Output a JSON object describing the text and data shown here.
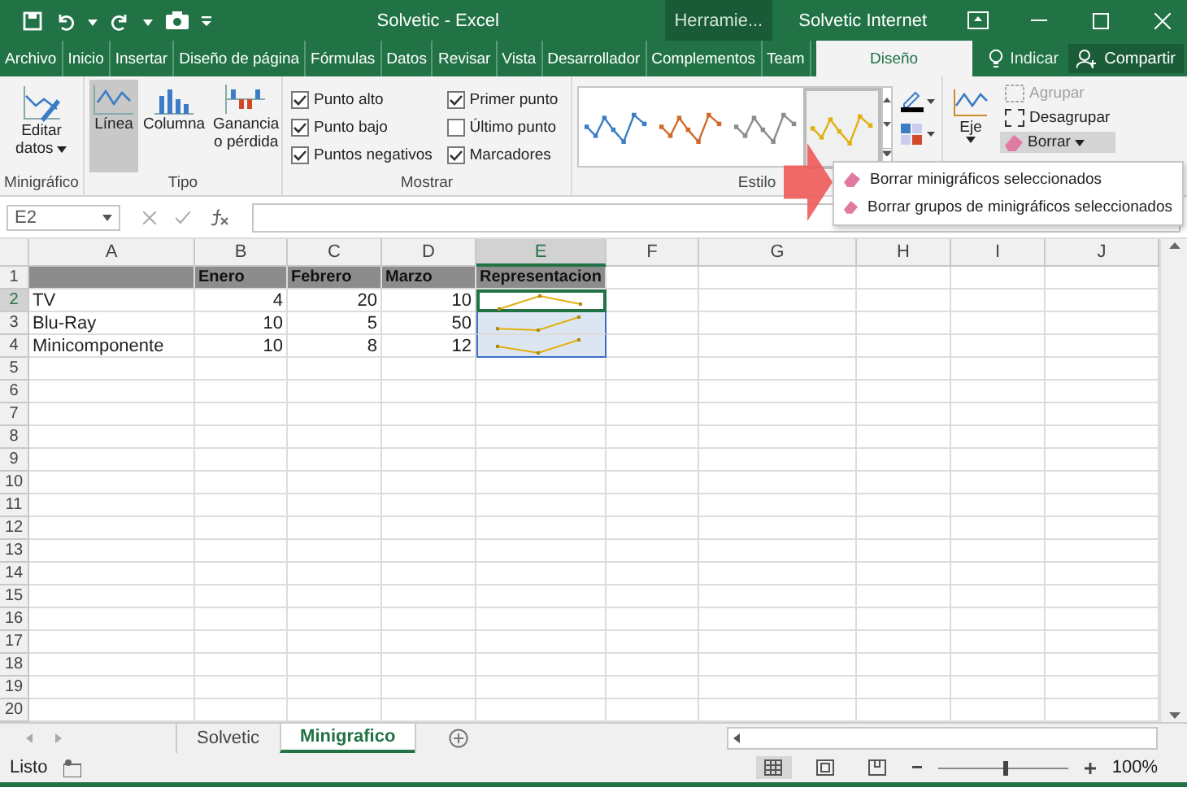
{
  "title_bar": {
    "title": "Solvetic - Excel",
    "context_label": "Herramie...",
    "account": "Solvetic Internet"
  },
  "ribbon_tabs": [
    {
      "label": "Archivo",
      "selected": false
    },
    {
      "label": "Inicio",
      "selected": false
    },
    {
      "label": "Insertar",
      "selected": false
    },
    {
      "label": "Diseño de página",
      "selected": false
    },
    {
      "label": "Fórmulas",
      "selected": false
    },
    {
      "label": "Datos",
      "selected": false
    },
    {
      "label": "Revisar",
      "selected": false
    },
    {
      "label": "Vista",
      "selected": false
    },
    {
      "label": "Desarrollador",
      "selected": false
    },
    {
      "label": "Complementos",
      "selected": false
    },
    {
      "label": "Team",
      "selected": false
    },
    {
      "label": "Diseño",
      "selected": true
    }
  ],
  "tell_me": "Indicar",
  "share": "Compartir",
  "ribbon": {
    "minigrafico": {
      "label": "Minigráfico",
      "edit_button": "Editar datos"
    },
    "tipo": {
      "label": "Tipo",
      "types": [
        {
          "label": "Línea",
          "selected": true
        },
        {
          "label": "Columna",
          "selected": false
        },
        {
          "label": "Ganancia o pérdida",
          "selected": false
        }
      ]
    },
    "mostrar": {
      "label": "Mostrar",
      "options": [
        {
          "label": "Punto alto",
          "checked": true
        },
        {
          "label": "Punto bajo",
          "checked": true
        },
        {
          "label": "Puntos negativos",
          "checked": true
        },
        {
          "label": "Primer punto",
          "checked": true
        },
        {
          "label": "Último punto",
          "checked": false
        },
        {
          "label": "Marcadores",
          "checked": true
        }
      ]
    },
    "estilo": {
      "label": "Estilo",
      "styles": [
        {
          "color": "#3a7dc4",
          "selected": false
        },
        {
          "color": "#d06a2a",
          "selected": false
        },
        {
          "color": "#8c8c8c",
          "selected": false
        },
        {
          "color": "#e0b010",
          "selected": true
        }
      ]
    },
    "agrupar": {
      "axis_button": "Eje",
      "buttons": [
        {
          "label": "Agrupar",
          "disabled": true,
          "expanded": false
        },
        {
          "label": "Desagrupar",
          "disabled": false,
          "expanded": false
        },
        {
          "label": "Borrar",
          "disabled": false,
          "expanded": true
        }
      ]
    }
  },
  "dropdown_menu": [
    "Borrar minigráficos seleccionados",
    "Borrar grupos de minigráficos seleccionados"
  ],
  "formula_bar": {
    "name_box": "E2"
  },
  "sheet": {
    "columns": [
      {
        "label": "A",
        "selected": false
      },
      {
        "label": "B",
        "selected": false
      },
      {
        "label": "C",
        "selected": false
      },
      {
        "label": "D",
        "selected": false
      },
      {
        "label": "E",
        "selected": true
      },
      {
        "label": "F",
        "selected": false
      },
      {
        "label": "G",
        "selected": false
      },
      {
        "label": "H",
        "selected": false
      },
      {
        "label": "I",
        "selected": false
      },
      {
        "label": "J",
        "selected": false
      }
    ],
    "row_headers": [
      {
        "label": "1",
        "selected": false
      },
      {
        "label": "2",
        "selected": true
      },
      {
        "label": "3",
        "selected": false
      },
      {
        "label": "4",
        "selected": false
      },
      {
        "label": "5",
        "selected": false
      },
      {
        "label": "6",
        "selected": false
      },
      {
        "label": "7",
        "selected": false
      },
      {
        "label": "8",
        "selected": false
      },
      {
        "label": "9",
        "selected": false
      },
      {
        "label": "10",
        "selected": false
      },
      {
        "label": "11",
        "selected": false
      },
      {
        "label": "12",
        "selected": false
      },
      {
        "label": "13",
        "selected": false
      },
      {
        "label": "14",
        "selected": false
      },
      {
        "label": "15",
        "selected": false
      },
      {
        "label": "16",
        "selected": false
      },
      {
        "label": "17",
        "selected": false
      },
      {
        "label": "18",
        "selected": false
      },
      {
        "label": "19",
        "selected": false
      },
      {
        "label": "20",
        "selected": false
      }
    ],
    "header_row": [
      "Enero",
      "Febrero",
      "Marzo",
      "Representacion"
    ],
    "rows": [
      {
        "label": "TV",
        "values": [
          "4",
          "20",
          "10"
        ],
        "sparkline": true
      },
      {
        "label": "Blu-Ray",
        "values": [
          "10",
          "5",
          "50"
        ],
        "sparkline": true
      },
      {
        "label": "Minicomponente",
        "values": [
          "10",
          "8",
          "12"
        ],
        "sparkline": true
      }
    ]
  },
  "sheet_tabs": [
    {
      "label": "Solvetic",
      "selected": false
    },
    {
      "label": "Minigrafico",
      "selected": true
    }
  ],
  "status_bar": {
    "status": "Listo",
    "zoom": {
      "level": 0.5,
      "reading": "100%"
    }
  }
}
